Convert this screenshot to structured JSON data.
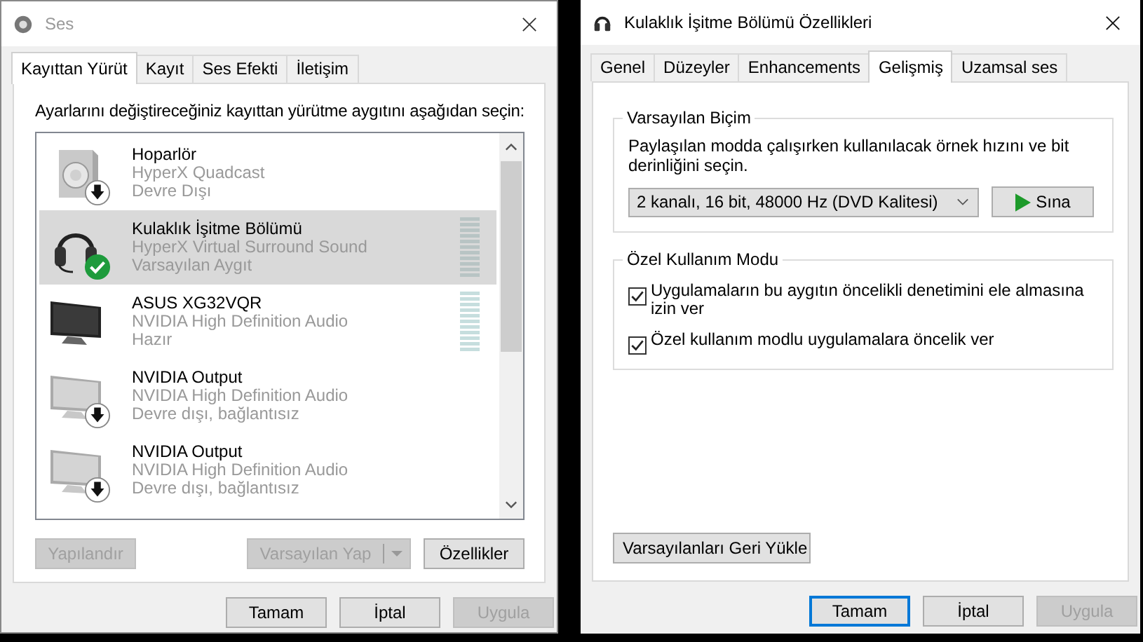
{
  "sound_window": {
    "title": "Ses",
    "tabs": [
      {
        "label": "Kayıttan Yürüt",
        "selected": true
      },
      {
        "label": "Kayıt",
        "selected": false
      },
      {
        "label": "Ses Efekti",
        "selected": false
      },
      {
        "label": "İletişim",
        "selected": false
      }
    ],
    "instruction": "Ayarlarını değiştireceğiniz kayıttan yürütme aygıtını aşağıdan seçin:",
    "devices": [
      {
        "kind": "speaker",
        "name": "Hoparlör",
        "driver": "HyperX Quadcast",
        "status": "Devre Dışı",
        "disabled": true,
        "default": false,
        "selected": false,
        "meter": false
      },
      {
        "kind": "headset",
        "name": "Kulaklık İşitme Bölümü",
        "driver": "HyperX Virtual Surround Sound",
        "status": "Varsayılan Aygıt",
        "disabled": false,
        "default": true,
        "selected": true,
        "meter": true
      },
      {
        "kind": "monitor",
        "name": "ASUS XG32VQR",
        "driver": "NVIDIA High Definition Audio",
        "status": "Hazır",
        "disabled": false,
        "default": false,
        "selected": false,
        "meter": true
      },
      {
        "kind": "monitor_off",
        "name": "NVIDIA Output",
        "driver": "NVIDIA High Definition Audio",
        "status": "Devre dışı, bağlantısız",
        "disabled": true,
        "default": false,
        "selected": false,
        "meter": false
      },
      {
        "kind": "monitor_off",
        "name": "NVIDIA Output",
        "driver": "NVIDIA High Definition Audio",
        "status": "Devre dışı, bağlantısız",
        "disabled": true,
        "default": false,
        "selected": false,
        "meter": false
      }
    ],
    "configure_button": {
      "label": "Yapılandır",
      "disabled": true
    },
    "set_default_button": {
      "label": "Varsayılan Yap",
      "disabled": true
    },
    "properties_button": {
      "label": "Özellikler",
      "disabled": false
    },
    "footer_buttons": [
      {
        "label": "Tamam",
        "disabled": false,
        "focused": false
      },
      {
        "label": "İptal",
        "disabled": false,
        "focused": false
      },
      {
        "label": "Uygula",
        "disabled": true,
        "focused": false
      }
    ]
  },
  "properties_window": {
    "title": "Kulaklık İşitme Bölümü Özellikleri",
    "tabs": [
      {
        "label": "Genel",
        "selected": false
      },
      {
        "label": "Düzeyler",
        "selected": false
      },
      {
        "label": "Enhancements",
        "selected": false
      },
      {
        "label": "Gelişmiş",
        "selected": true
      },
      {
        "label": "Uzamsal ses",
        "selected": false
      }
    ],
    "default_format": {
      "title": "Varsayılan Biçim",
      "description": "Paylaşılan modda çalışırken kullanılacak örnek hızını ve bit derinliğini seçin.",
      "format_value": "2 kanalı, 16 bit, 48000 Hz (DVD Kalitesi)",
      "test_button": "Sına"
    },
    "exclusive_mode": {
      "title": "Özel Kullanım Modu",
      "options": [
        {
          "label": "Uygulamaların bu aygıtın öncelikli denetimini ele almasına izin ver",
          "checked": true
        },
        {
          "label": "Özel kullanım modlu uygulamalara öncelik ver",
          "checked": true
        }
      ]
    },
    "restore_button": "Varsayılanları Geri Yükle",
    "footer_buttons": [
      {
        "label": "Tamam",
        "disabled": false,
        "focused": true
      },
      {
        "label": "İptal",
        "disabled": false,
        "focused": false
      },
      {
        "label": "Uygula",
        "disabled": true,
        "focused": false
      }
    ]
  }
}
